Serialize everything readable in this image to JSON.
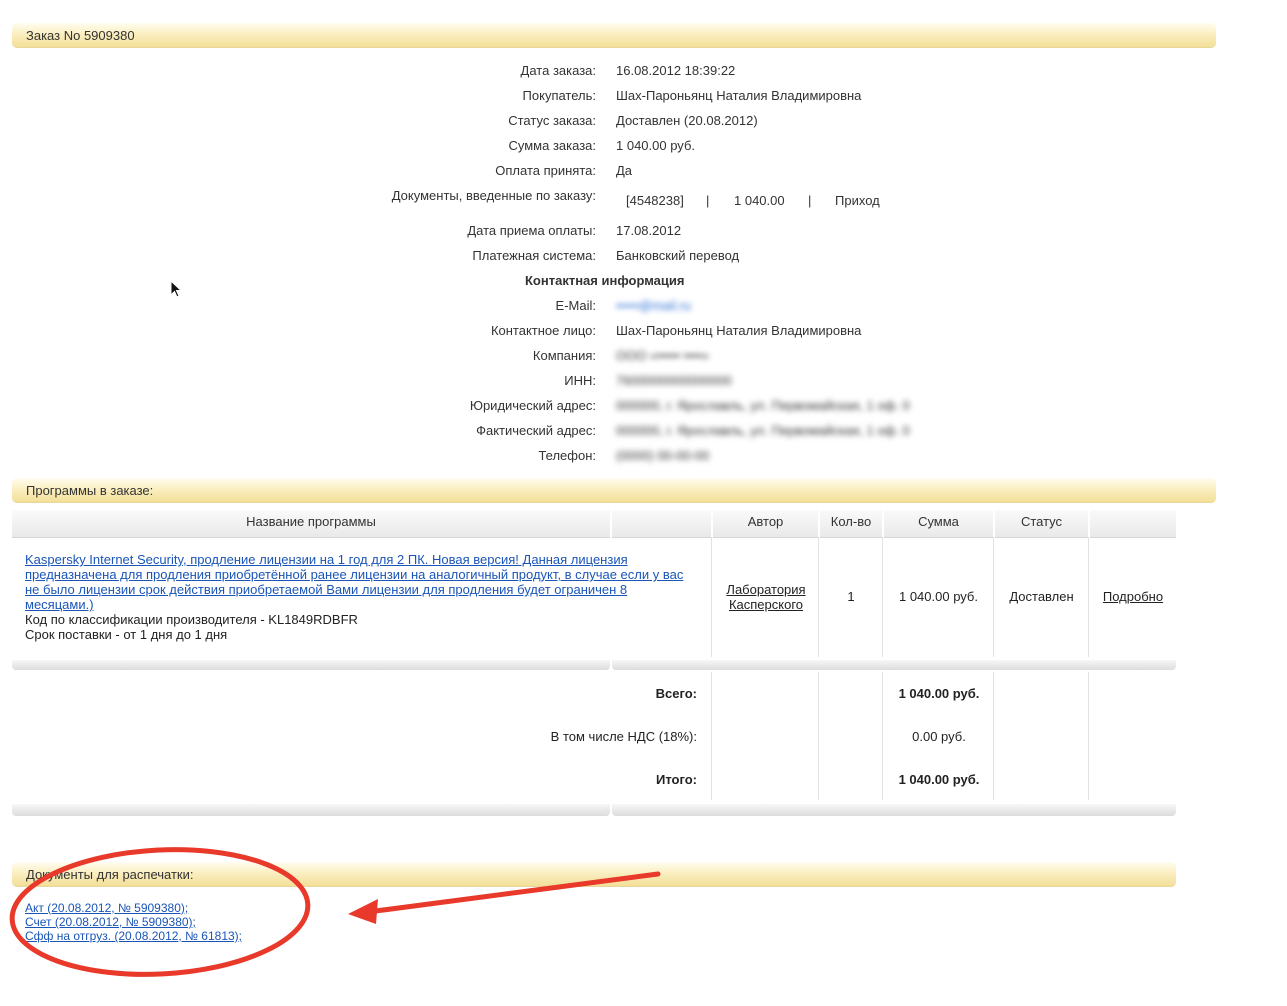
{
  "order": {
    "title": "Заказ No 5909380",
    "fields": [
      {
        "label": "Дата заказа:",
        "value": "16.08.2012 18:39:22"
      },
      {
        "label": "Покупатель:",
        "value": "Шах-Пароньянц Наталия Владимировна"
      },
      {
        "label": "Статус заказа:",
        "value": "Доставлен (20.08.2012)"
      },
      {
        "label": "Сумма заказа:",
        "value": "1 040.00 руб."
      },
      {
        "label": "Оплата принята:",
        "value": "Да"
      }
    ],
    "documents_label": "Документы, введенные по заказу:",
    "documents": {
      "id": "[4548238]",
      "sep1": "|",
      "amount": "1 040.00",
      "sep2": "|",
      "type": "Приход"
    },
    "payment_fields": [
      {
        "label": "Дата приема оплаты:",
        "value": "17.08.2012"
      },
      {
        "label": "Платежная система:",
        "value": "Банковский перевод"
      }
    ]
  },
  "contact": {
    "heading": "Контактная информация",
    "fields": [
      {
        "label": "E-Mail:",
        "value": "•••••@mail.ru"
      },
      {
        "label": "Контактное лицо:",
        "value": "Шах-Пароньянц Наталия Владимировна"
      },
      {
        "label": "Компания:",
        "value": "ООО «••••• ••••»"
      },
      {
        "label": "ИНН:",
        "value": "7600000000000000"
      },
      {
        "label": "Юридический адрес:",
        "value": "000000, г. Ярославль, ул. Первомайская, 1 оф. 0"
      },
      {
        "label": "Фактический адрес:",
        "value": "000000, г. Ярославль, ул. Первомайская, 1 оф. 0"
      },
      {
        "label": "Телефон:",
        "value": "(0000) 00-00-00"
      }
    ]
  },
  "programs": {
    "title": "Программы в заказе:",
    "columns": [
      "Название программы",
      "Автор",
      "Кол-во",
      "Сумма",
      "Статус"
    ],
    "item": {
      "name": "Kaspersky Internet Security, продление лицензии на 1 год для 2 ПК. Новая версия! Данная лицензия предназначена для продления приобретённой ранее лицензии на аналогичный продукт, в случае если у вас не было лицензии срок действия приобретаемой Вами лицензии для продления будет ограничен 8 месяцами.)",
      "code": "Код по классификации производителя - KL1849RDBFR",
      "delivery": "Срок поставки - от 1  дня  до 1  дня",
      "author": "Лаборатория Касперского",
      "qty": "1",
      "sum": "1 040.00 руб.",
      "status": "Доставлен",
      "details": "Подробно"
    },
    "totals": [
      {
        "label": "Всего:",
        "value": "1 040.00 руб."
      },
      {
        "label": "В том числе НДС (18%):",
        "value": "0.00 руб."
      },
      {
        "label": "Итого:",
        "value": "1 040.00 руб."
      }
    ]
  },
  "print": {
    "title": "Документы для распечатки:",
    "links": [
      "Акт (20.08.2012, № 5909380);",
      "Счет (20.08.2012, № 5909380);",
      "Сфф на отгруз. (20.08.2012, № 61813);"
    ]
  },
  "colors": {
    "annotation": "#e8392a",
    "link": "#1a55b8",
    "section_bar": "#f2df98"
  }
}
